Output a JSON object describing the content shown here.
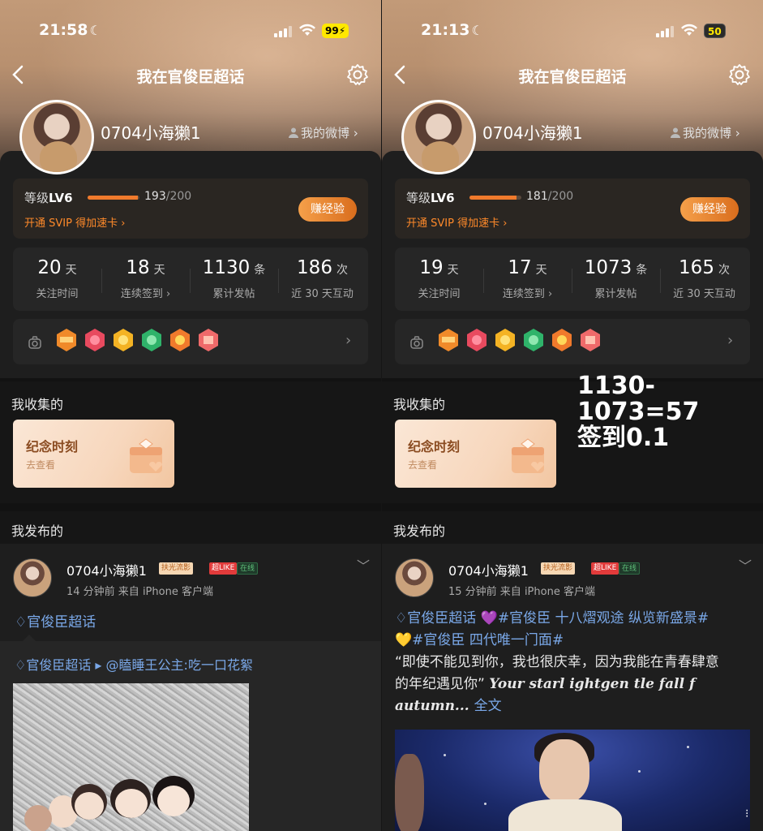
{
  "page": {
    "title": "我在官俊臣超话"
  },
  "colors": {
    "accent": "#f07a2c",
    "link": "#7aa8e8",
    "svip": "#ff8a2a"
  },
  "panels": [
    {
      "status": {
        "time": "21:58",
        "battery": "99"
      },
      "profile": {
        "username": "0704小海獭1",
        "my_weibo": "我的微博 ›"
      },
      "level": {
        "label_prefix": "等级",
        "level": "LV6",
        "exp_current": "193",
        "exp_total": "/200",
        "progress": 0.965,
        "svip": "开通 SVIP 得加速卡 ›",
        "earn_button": "赚经验"
      },
      "stats": [
        {
          "num": "20",
          "unit": "天",
          "label": "关注时间"
        },
        {
          "num": "18",
          "unit": "天",
          "label": "连续签到 ›"
        },
        {
          "num": "1130",
          "unit": "条",
          "label": "累计发帖"
        },
        {
          "num": "186",
          "unit": "次",
          "label": "近 30 天互动"
        }
      ],
      "collections": {
        "title": "我收集的",
        "card_title": "纪念时刻",
        "card_sub": "去查看"
      },
      "published": {
        "title": "我发布的"
      },
      "post": {
        "name": "0704小海獭1",
        "tag_fx": "扶光流影",
        "tag_sl": "超LIKE",
        "tag_ol": "在线",
        "meta": "14 分钟前   来自 iPhone 客户端",
        "topic": "官俊臣超话",
        "repost": "官俊臣超话 ▸ @瞌睡王公主:吃一口花絮"
      }
    },
    {
      "status": {
        "time": "21:13",
        "battery": "50"
      },
      "profile": {
        "username": "0704小海獭1",
        "my_weibo": "我的微博 ›"
      },
      "level": {
        "label_prefix": "等级",
        "level": "LV6",
        "exp_current": "181",
        "exp_total": "/200",
        "progress": 0.905,
        "svip": "开通 SVIP 得加速卡 ›",
        "earn_button": "赚经验"
      },
      "stats": [
        {
          "num": "19",
          "unit": "天",
          "label": "关注时间"
        },
        {
          "num": "17",
          "unit": "天",
          "label": "连续签到 ›"
        },
        {
          "num": "1073",
          "unit": "条",
          "label": "累计发帖"
        },
        {
          "num": "165",
          "unit": "次",
          "label": "近 30 天互动"
        }
      ],
      "collections": {
        "title": "我收集的",
        "card_title": "纪念时刻",
        "card_sub": "去查看"
      },
      "published": {
        "title": "我发布的"
      },
      "post": {
        "name": "0704小海獭1",
        "tag_fx": "扶光流影",
        "tag_sl": "超LIKE",
        "tag_ol": "在线",
        "meta": "15 分钟前   来自 iPhone 客户端",
        "line1": "官俊臣超话  💜#官俊臣 十八熠观途 纵览新盛景#",
        "line2": "💛#官俊臣 四代唯一门面#",
        "line3": "“即使不能见到你，我也很庆幸，因为我能在青春肆意",
        "line4a": "的年纪遇见你”  ",
        "line4b": "Your starl ightgen tle fall f",
        "line5a": "autumn... ",
        "line5b": "全文"
      }
    }
  ],
  "overlay": {
    "line1": "1130-1073=57",
    "line2": "签到0.1"
  }
}
